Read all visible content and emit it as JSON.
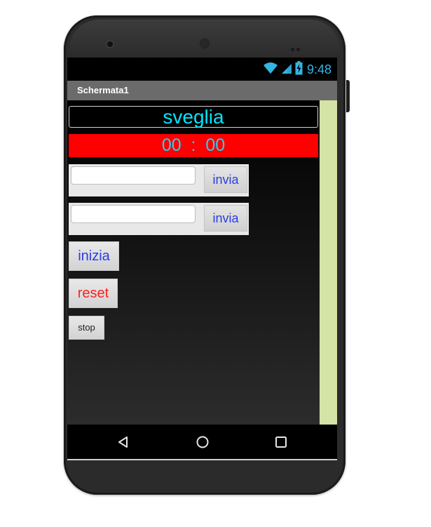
{
  "status_bar": {
    "time": "9:48",
    "icons": [
      "wifi-icon",
      "cell-signal-icon",
      "battery-charging-icon"
    ],
    "accent_color": "#33b5e5"
  },
  "app": {
    "title": "Schermata1"
  },
  "alarm": {
    "label": "sveglia",
    "time_display": "00  :  00",
    "label_color": "#00e5ff",
    "time_bg_color": "#ff0000"
  },
  "inputs": [
    {
      "value": "",
      "placeholder": "",
      "button_label": "invia"
    },
    {
      "value": "",
      "placeholder": "",
      "button_label": "invia"
    }
  ],
  "buttons": {
    "start_label": "inizia",
    "reset_label": "reset",
    "stop_label": "stop"
  },
  "side_panel_color": "#d4e3a6",
  "nav": {
    "icons": [
      "back-triangle-icon",
      "home-circle-icon",
      "recents-square-icon"
    ]
  }
}
